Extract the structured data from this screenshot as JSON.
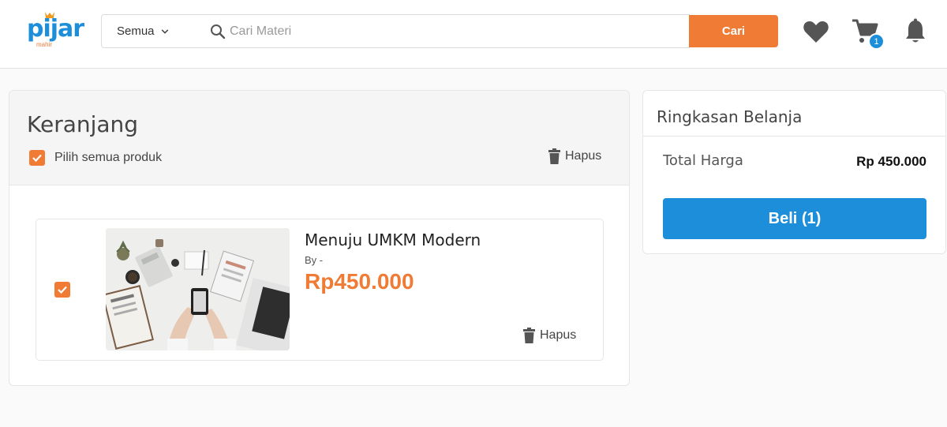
{
  "header": {
    "logo_text": "pijar",
    "logo_sub": "mahir",
    "category_label": "Semua",
    "search_placeholder": "Cari Materi",
    "search_value": "",
    "search_button": "Cari",
    "cart_count": "1",
    "icons": [
      "heart-icon",
      "cart-icon",
      "bell-icon",
      "search-icon",
      "chevron-down-icon",
      "trash-icon"
    ],
    "colors": {
      "brand_blue": "#1d8ed9",
      "brand_orange": "#ef7b35"
    }
  },
  "cart": {
    "title": "Keranjang",
    "select_all_label": "Pilih semua produk",
    "select_all_checked": true,
    "delete_all_label": "Hapus",
    "items": [
      {
        "title": "Menuju UMKM Modern",
        "by": "By -",
        "price": "Rp450.000",
        "checked": true,
        "delete_label": "Hapus"
      }
    ]
  },
  "summary": {
    "title": "Ringkasan Belanja",
    "total_label": "Total Harga",
    "total_value": "Rp 450.000",
    "buy_button": "Beli (1)"
  }
}
